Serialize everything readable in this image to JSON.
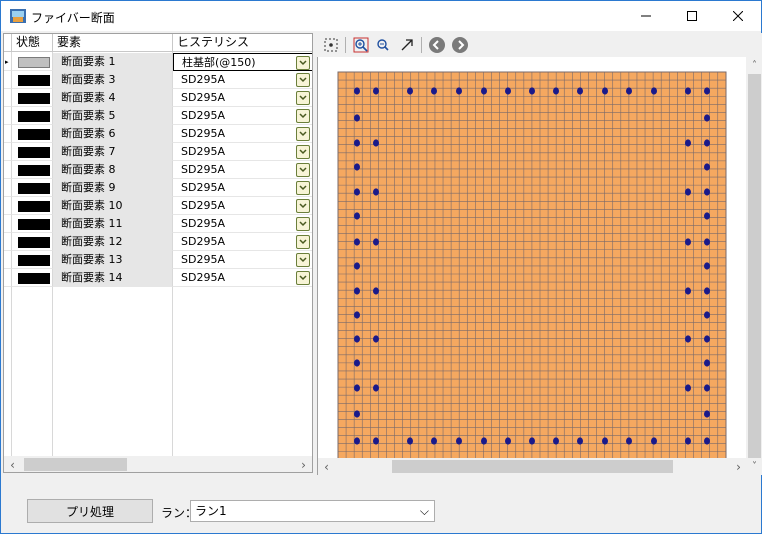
{
  "window": {
    "title": "ファイバー断面"
  },
  "grid": {
    "columns": {
      "status": "状態",
      "element": "要素",
      "hysteresis": "ヒステリシス"
    },
    "rows": [
      {
        "status": "gray",
        "element": "断面要素 1",
        "hysteresis": "柱基部(@150)"
      },
      {
        "status": "black",
        "element": "断面要素 3",
        "hysteresis": "SD295A"
      },
      {
        "status": "black",
        "element": "断面要素 4",
        "hysteresis": "SD295A"
      },
      {
        "status": "black",
        "element": "断面要素 5",
        "hysteresis": "SD295A"
      },
      {
        "status": "black",
        "element": "断面要素 6",
        "hysteresis": "SD295A"
      },
      {
        "status": "black",
        "element": "断面要素 7",
        "hysteresis": "SD295A"
      },
      {
        "status": "black",
        "element": "断面要素 8",
        "hysteresis": "SD295A"
      },
      {
        "status": "black",
        "element": "断面要素 9",
        "hysteresis": "SD295A"
      },
      {
        "status": "black",
        "element": "断面要素 10",
        "hysteresis": "SD295A"
      },
      {
        "status": "black",
        "element": "断面要素 11",
        "hysteresis": "SD295A"
      },
      {
        "status": "black",
        "element": "断面要素 12",
        "hysteresis": "SD295A"
      },
      {
        "status": "black",
        "element": "断面要素 13",
        "hysteresis": "SD295A"
      },
      {
        "status": "black",
        "element": "断面要素 14",
        "hysteresis": "SD295A"
      }
    ],
    "scroll_left_arrow": "‹",
    "scroll_right_arrow": "›"
  },
  "toolbar": {
    "icons": [
      "fit-view-icon",
      "zoom-in-icon",
      "zoom-out-icon",
      "pan-arrow-icon",
      "back-icon",
      "forward-icon"
    ]
  },
  "section_view": {
    "colors": {
      "concrete": "#f5a860",
      "mesh": "#7a6a6a",
      "rebar": "#1a1a8a"
    },
    "scroll_up_arrow": "˄",
    "scroll_down_arrow": "˅",
    "scroll_left_arrow": "‹",
    "scroll_right_arrow": "›"
  },
  "bottom": {
    "pre_process_button": "プリ処理",
    "run_label": "ラン：",
    "run_selected": "ラン1",
    "run_chevron": "⌵"
  }
}
